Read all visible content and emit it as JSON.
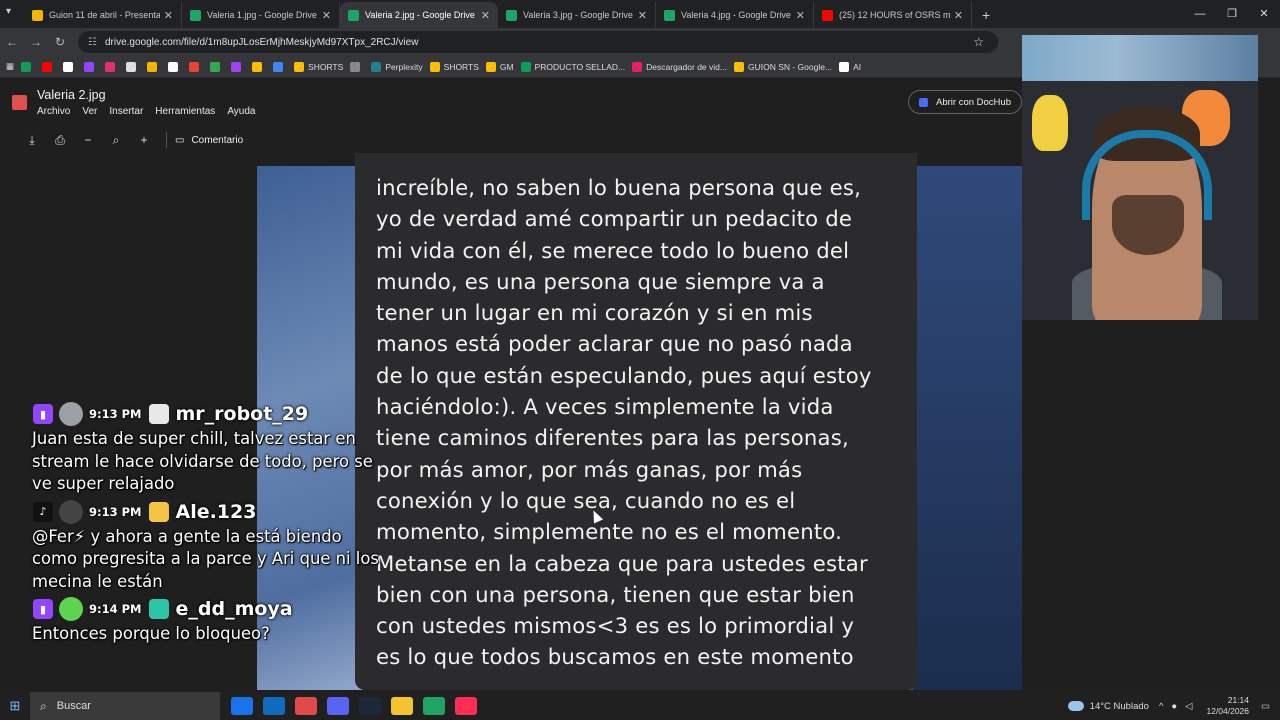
{
  "browser": {
    "tabs": [
      {
        "title": "Guion 11 de abril - Presentació",
        "fav_color": "#f4b400"
      },
      {
        "title": "Valeria 1.jpg - Google Drive",
        "fav_color": "#1fa463"
      },
      {
        "title": "Valeria 2.jpg - Google Drive",
        "fav_color": "#1fa463",
        "active": true
      },
      {
        "title": "Valeria 3.jpg - Google Drive",
        "fav_color": "#1fa463"
      },
      {
        "title": "Valeria 4.jpg - Google Drive",
        "fav_color": "#1fa463"
      },
      {
        "title": "(25) 12 HOURS of OSRS mu",
        "fav_color": "#ff0000"
      }
    ],
    "url": "drive.google.com/file/d/1m8upJLosErMjhMeskjyMd97XTpx_2RCJ/view",
    "bookmarks": [
      {
        "label": "",
        "color": "#0f9d58"
      },
      {
        "label": "",
        "color": "#ff0000"
      },
      {
        "label": "",
        "color": "#ffffff"
      },
      {
        "label": "",
        "color": "#9146ff"
      },
      {
        "label": "",
        "color": "#e1306c"
      },
      {
        "label": "",
        "color": "#dddddd"
      },
      {
        "label": "",
        "color": "#f4b400"
      },
      {
        "label": "",
        "color": "#ffffff"
      },
      {
        "label": "",
        "color": "#ea4335"
      },
      {
        "label": "",
        "color": "#34a853"
      },
      {
        "label": "",
        "color": "#a142f4"
      },
      {
        "label": "",
        "color": "#fbbc04"
      },
      {
        "label": "",
        "color": "#4285f4"
      },
      {
        "label": "SHORTS",
        "color": "#fbbc04"
      },
      {
        "label": "",
        "color": "#888888"
      },
      {
        "label": "Perplexity",
        "color": "#20808d"
      },
      {
        "label": "SHORTS",
        "color": "#fbbc04"
      },
      {
        "label": "GM",
        "color": "#fbbc04"
      },
      {
        "label": "PRODUCTO SELLAD...",
        "color": "#0f9d58"
      },
      {
        "label": "Descargador de vid...",
        "color": "#e91e63"
      },
      {
        "label": "GUION SN - Google...",
        "color": "#fbbc04"
      },
      {
        "label": "AI",
        "color": "#ffffff"
      }
    ]
  },
  "doc": {
    "title": "Valeria 2.jpg",
    "menus": [
      "Archivo",
      "Ver",
      "Insertar",
      "Herramientas",
      "Ayuda"
    ],
    "open_with": "Abrir con DocHub",
    "comment_label": "Comentario"
  },
  "image_text": [
    "increíble, no saben lo buena persona que es,",
    "yo de verdad amé compartir un pedacito de",
    "mi vida con él, se merece todo lo bueno del",
    "mundo, es una persona que siempre va a",
    "tener un lugar en mi corazón y si en mis",
    "manos está poder aclarar que no pasó nada",
    "de lo que están especulando, pues aquí estoy",
    "haciéndolo:). A veces simplemente la vida",
    "tiene caminos diferentes para las personas,",
    "por más amor, por más ganas, por más",
    "conexión y lo que sea, cuando no es el",
    "momento, simplemente no es el momento.",
    "Metanse en la cabeza que para ustedes estar",
    "bien con una persona, tienen que estar bien",
    "con ustedes mismos<3 es es lo primordial y",
    "es lo que todos buscamos en este momento"
  ],
  "chat": [
    {
      "platform": "twitch",
      "platform_color": "#9146ff",
      "avatar_color": "#9aa0a6",
      "time": "9:13 PM",
      "badge_color": "#e8e8e8",
      "username": "mr_robot_29",
      "lines": [
        "Juan esta de super chill, talvez estar en",
        "stream le hace olvidarse de todo, pero se",
        "ve super relajado"
      ]
    },
    {
      "platform": "tiktok",
      "platform_color": "#111111",
      "avatar_color": "#444444",
      "time": "9:13 PM",
      "badge_color": "#f4c542",
      "username": "Ale.123",
      "lines": [
        "@Fer⚡ y ahora a gente la está biendo",
        "como pregresita a la parce y Ari que ni los",
        "mecina le están"
      ]
    },
    {
      "platform": "twitch",
      "platform_color": "#9146ff",
      "avatar_color": "#5ed34f",
      "time": "9:14 PM",
      "badge_color": "#2ec4a6",
      "username": "e_dd_moya",
      "lines": [
        "Entonces porque lo bloqueo?"
      ]
    }
  ],
  "taskbar": {
    "search_placeholder": "Buscar",
    "apps": [
      "#1a73e8",
      "#0f6cbd",
      "#e04a4a",
      "#5865f2",
      "#1b2838",
      "#f4c430",
      "#1fa463",
      "#ff2d55"
    ],
    "weather": "14°C  Nublado",
    "time": "21:14",
    "date": "12/04/2026"
  }
}
